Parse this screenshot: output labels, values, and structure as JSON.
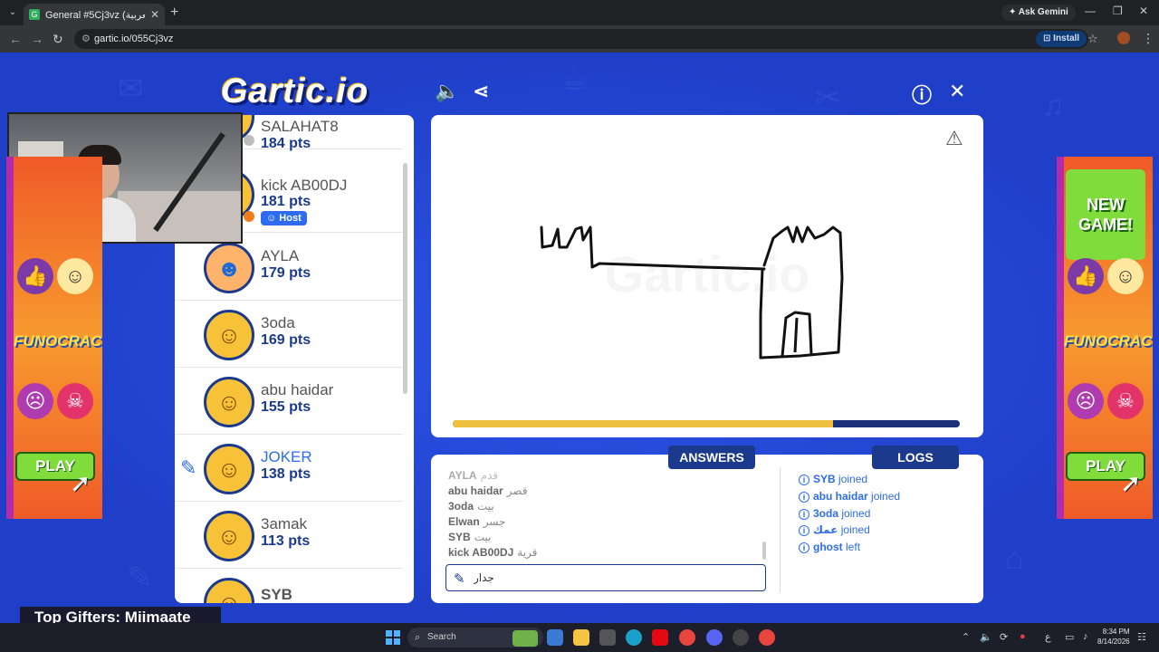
{
  "browser": {
    "tab_title": "General #5Cj3vz (العربية) - Gartic",
    "url": "gartic.io/055Cj3vz",
    "ask_gemini": "Ask Gemini",
    "install": "Install"
  },
  "game": {
    "logo": "Gartic.io",
    "drawing_progress": 0.75
  },
  "players": [
    {
      "name": "SALAHAT8",
      "points": "184 pts",
      "status_color": "#bdbdbd"
    },
    {
      "name": "kick AB00DJ",
      "points": "181 pts",
      "badge": "Host",
      "status_color": "#f07b1a"
    },
    {
      "name": "AYLA",
      "points": "179 pts"
    },
    {
      "name": "3oda",
      "points": "169 pts"
    },
    {
      "name": "abu haidar",
      "points": "155 pts"
    },
    {
      "name": "JOKER",
      "points": "138 pts",
      "drawing": true
    },
    {
      "name": "3amak",
      "points": "113 pts"
    },
    {
      "name": "SYB",
      "points": ""
    }
  ],
  "answers_header": "ANSWERS",
  "logs_header": "LOGS",
  "answers": [
    {
      "name": "AYLA",
      "guess": "قدم"
    },
    {
      "name": "abu haidar",
      "guess": "قصر"
    },
    {
      "name": "3oda",
      "guess": "بيت"
    },
    {
      "name": "Elwan",
      "guess": "جسر"
    },
    {
      "name": "SYB",
      "guess": "بيت"
    },
    {
      "name": "kick AB00DJ",
      "guess": "قرية"
    }
  ],
  "logs": [
    {
      "name": "SYB",
      "action": "joined"
    },
    {
      "name": "abu haidar",
      "action": "joined"
    },
    {
      "name": "3oda",
      "action": "joined"
    },
    {
      "name": "عمك",
      "action": "joined"
    },
    {
      "name": "ghost",
      "action": "left"
    }
  ],
  "answer_input_value": "جدار",
  "ads": {
    "new_game": "NEW GAME!",
    "brand": "FUNOCRACY",
    "play": "PLAY"
  },
  "stream": {
    "top_gifters": "Top Gifters: Miimaate"
  },
  "taskbar": {
    "search": "Search",
    "time": "8:34 PM",
    "date": "8/14/2026",
    "lang": "ع"
  }
}
